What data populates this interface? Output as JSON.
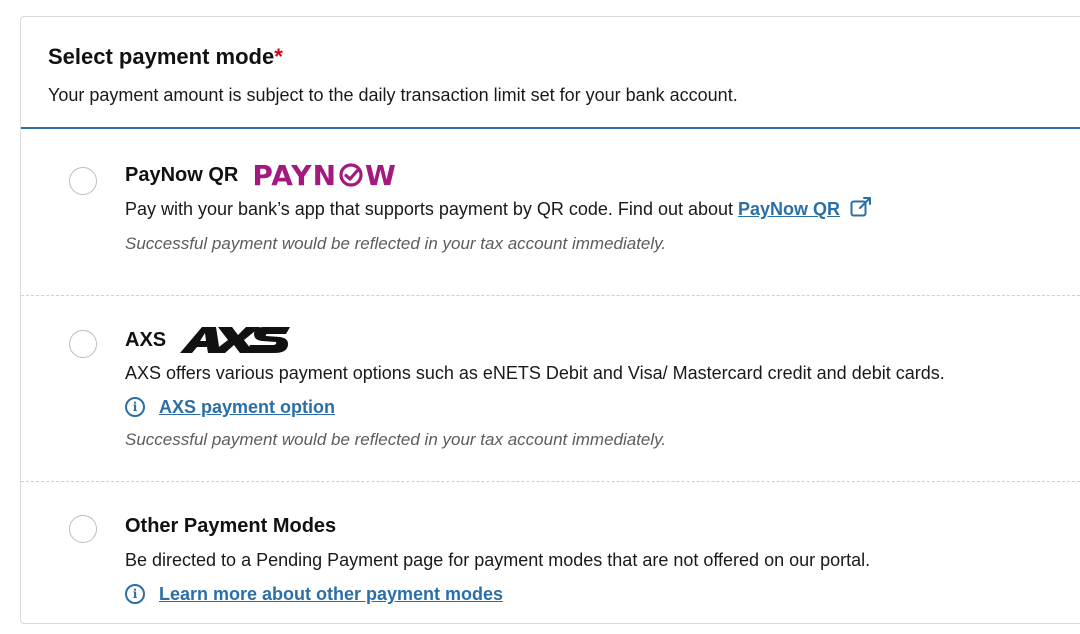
{
  "header": {
    "title": "Select payment mode",
    "required_mark": "*",
    "subtitle": "Your payment amount is subject to the daily transaction limit set for your bank account."
  },
  "options": [
    {
      "title": "PayNow QR",
      "logo_text": "PAYNOW",
      "logo_icon": "paynow-logo",
      "desc": "Pay with your bank’s app that supports payment by QR code. Find out about ",
      "link": "PayNow QR",
      "link_icon": "external-link-icon",
      "note": "Successful payment would be reflected in your tax account immediately."
    },
    {
      "title": "AXS",
      "logo_icon": "axs-logo",
      "desc": "AXS offers various payment options such as eNETS Debit and Visa/ Mastercard credit and debit cards.",
      "info_link": "AXS payment option",
      "note": "Successful payment would be reflected in your tax account immediately."
    },
    {
      "title": "Other Payment Modes",
      "desc": "Be directed to a Pending Payment page for payment modes that are not offered on our portal.",
      "info_link": "Learn more about other payment modes"
    }
  ],
  "colors": {
    "accent": "#2b6fa6",
    "required": "#d0021b",
    "paynow": "#a3197f"
  }
}
